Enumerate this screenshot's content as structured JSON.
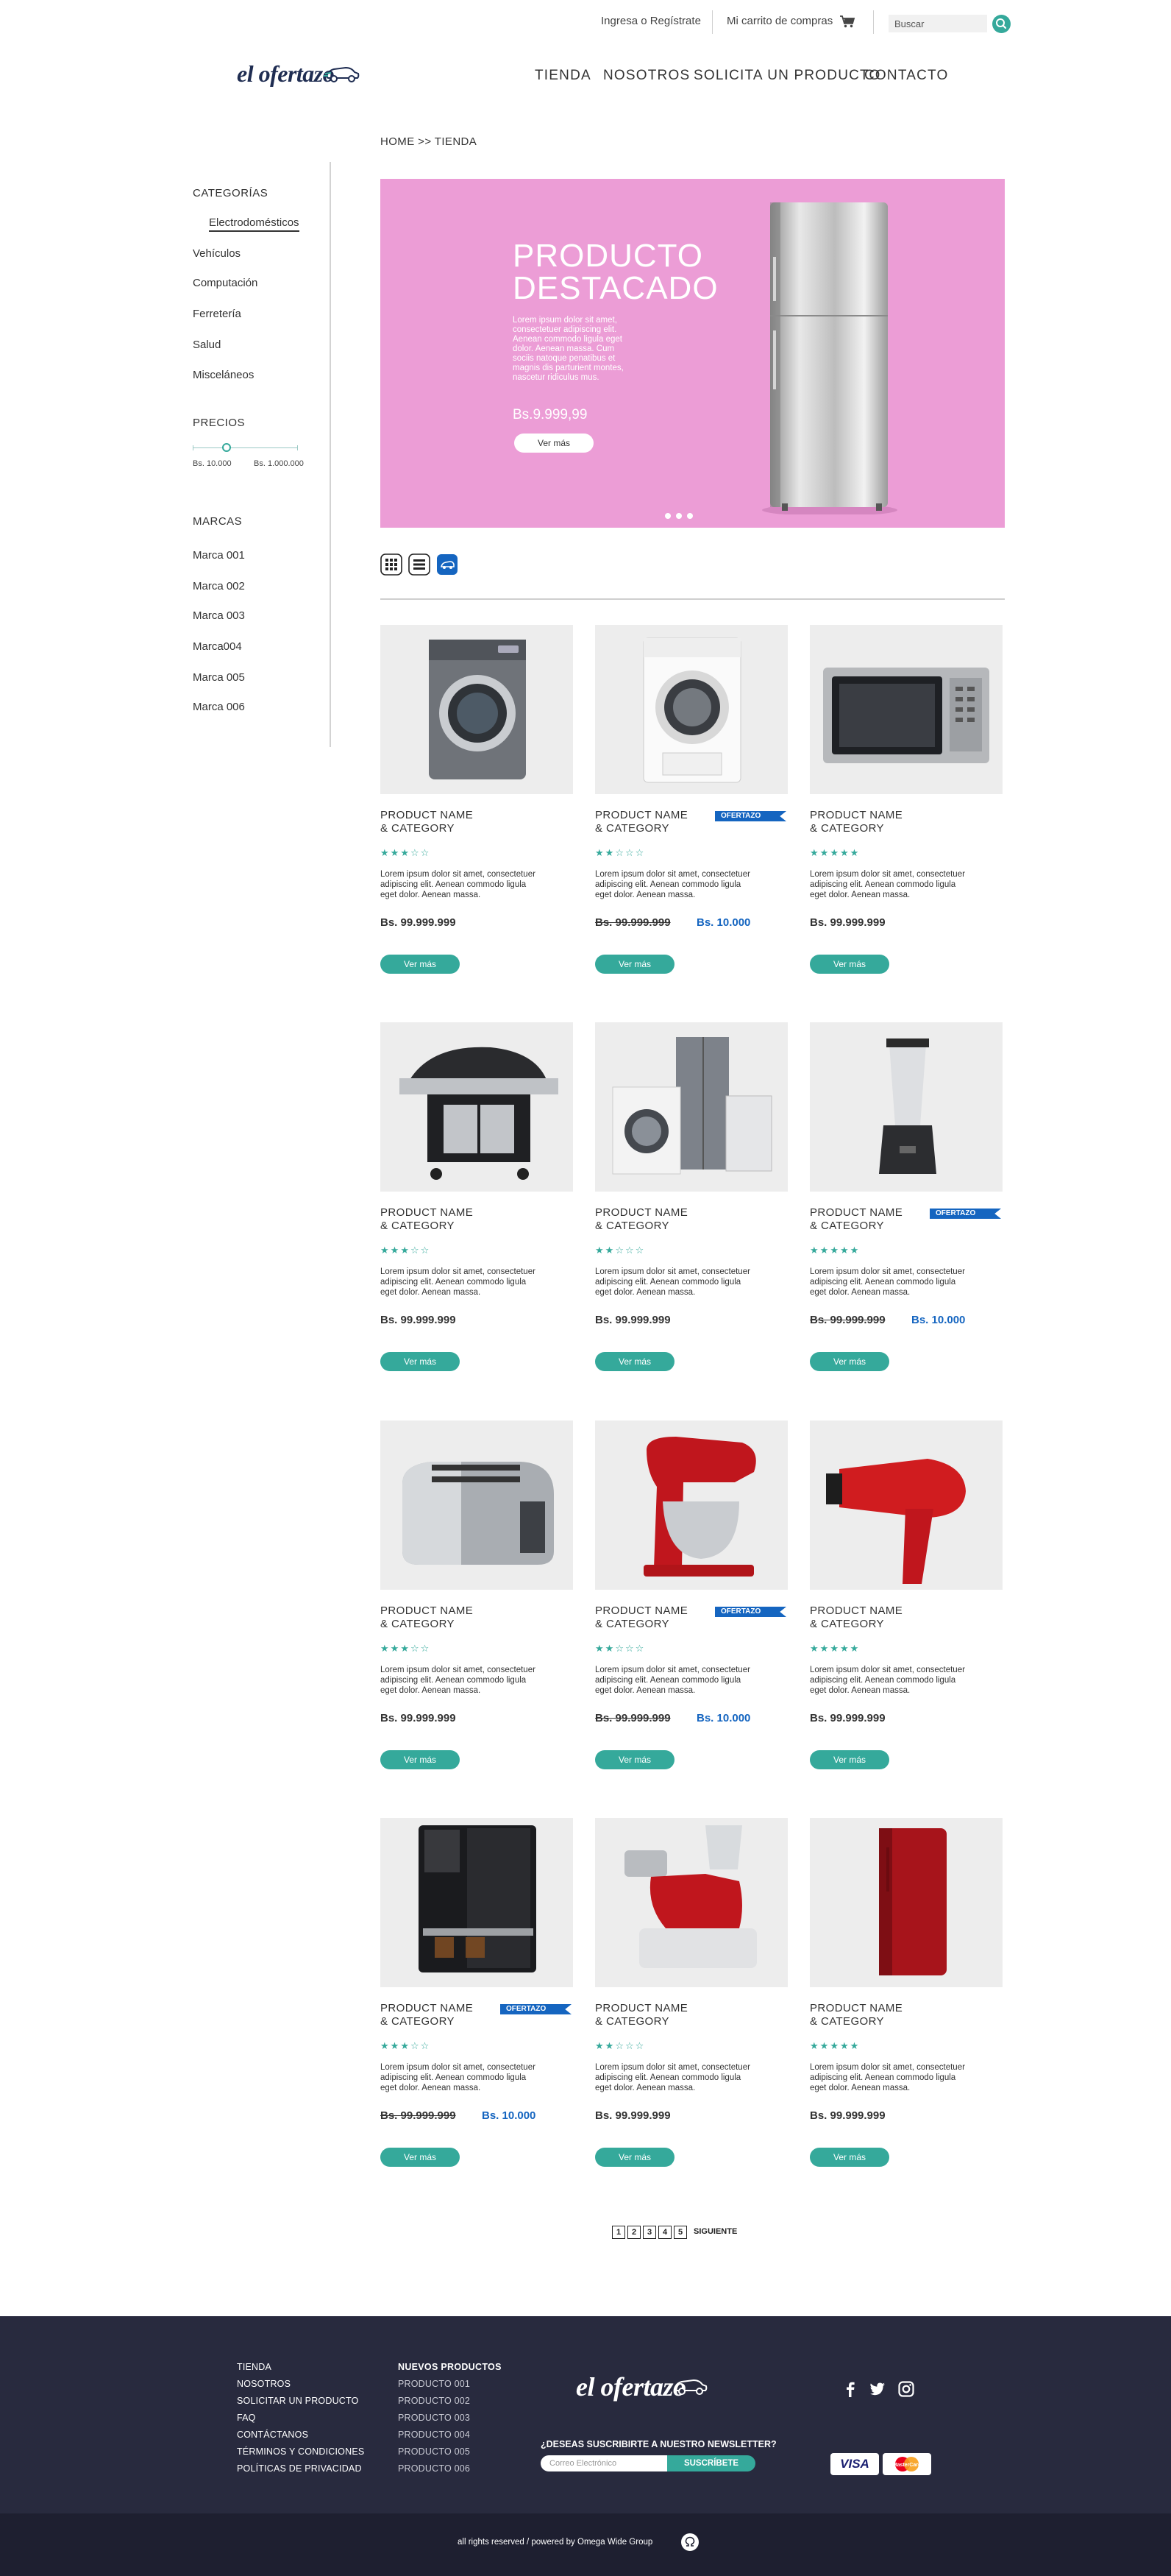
{
  "topbar": {
    "login_label": "Ingresa o Regístrate",
    "cart_label": "Mi carrito de compras",
    "search_placeholder": "Buscar"
  },
  "brand": {
    "logo_text": "el ofertazo"
  },
  "nav": [
    "TIENDA",
    "NOSOTROS",
    "SOLICITA UN PRODUCTO",
    "CONTACTO"
  ],
  "breadcrumb": "HOME >> TIENDA",
  "sidebar": {
    "categories_heading": "CATEGORÍAS",
    "categories": [
      "Electrodomésticos",
      "Vehículos",
      "Computación",
      "Ferretería",
      "Salud",
      "Misceláneos"
    ],
    "prices_heading": "PRECIOS",
    "price_min": "Bs. 10.000",
    "price_max": "Bs. 1.000.000",
    "price_slider_fraction": 0.33,
    "brands_heading": "MARCAS",
    "brands": [
      "Marca 001",
      "Marca 002",
      "Marca 003",
      "Marca004",
      "Marca 005",
      "Marca 006"
    ]
  },
  "hero": {
    "title_line1": "PRODUCTO",
    "title_line2": "DESTACADO",
    "text": "Lorem ipsum dolor sit amet, consectetuer adipiscing elit. Aenean commodo ligula eget dolor. Aenean massa. Cum sociis natoque penatibus et magnis dis parturient montes, nascetur ridiculus mus.",
    "price": "Bs.9.999,99",
    "button_label": "Ver más",
    "background_color": "#ec9dd6",
    "slide_count": 3
  },
  "view_toggles": [
    "grid-view-icon",
    "list-view-icon",
    "ofertazo-view-icon"
  ],
  "products": [
    {
      "name1": "PRODUCT NAME",
      "name2": "& CATEGORY",
      "image": "washing-machine-dark",
      "rating": 3,
      "badge": "",
      "price": "Bs. 99.999.999",
      "sale_price": "",
      "desc": "Lorem ipsum dolor sit amet, consectetuer adipiscing elit. Aenean commodo ligula eget dolor. Aenean massa.",
      "button": "Ver más"
    },
    {
      "name1": "PRODUCT NAME",
      "name2": "& CATEGORY",
      "image": "washing-machine-white",
      "rating": 2,
      "badge": "OFERTAZO",
      "price": "Bs. 99.999.999",
      "sale_price": "Bs. 10.000",
      "desc": "Lorem ipsum dolor sit amet, consectetuer adipiscing elit. Aenean commodo ligula eget dolor. Aenean massa.",
      "button": "Ver más"
    },
    {
      "name1": "PRODUCT NAME",
      "name2": "& CATEGORY",
      "image": "microwave",
      "rating": 5,
      "badge": "",
      "price": "Bs. 99.999.999",
      "sale_price": "",
      "desc": "Lorem ipsum dolor sit amet, consectetuer adipiscing elit. Aenean commodo ligula eget dolor. Aenean massa.",
      "button": "Ver más"
    },
    {
      "name1": "PRODUCT NAME",
      "name2": "& CATEGORY",
      "image": "grill",
      "rating": 3,
      "badge": "",
      "price": "Bs. 99.999.999",
      "sale_price": "",
      "desc": "Lorem ipsum dolor sit amet, consectetuer adipiscing elit. Aenean commodo ligula eget dolor. Aenean massa.",
      "button": "Ver más"
    },
    {
      "name1": "PRODUCT NAME",
      "name2": "& CATEGORY",
      "image": "appliance-set",
      "rating": 2,
      "badge": "",
      "price": "Bs. 99.999.999",
      "sale_price": "",
      "desc": "Lorem ipsum dolor sit amet, consectetuer adipiscing elit. Aenean commodo ligula eget dolor. Aenean massa.",
      "button": "Ver más"
    },
    {
      "name1": "PRODUCT NAME",
      "name2": "& CATEGORY",
      "image": "blender",
      "rating": 5,
      "badge": "OFERTAZO",
      "price": "Bs. 99.999.999",
      "sale_price": "Bs. 10.000",
      "desc": "Lorem ipsum dolor sit amet, consectetuer adipiscing elit. Aenean commodo ligula eget dolor. Aenean massa.",
      "button": "Ver más"
    },
    {
      "name1": "PRODUCT NAME",
      "name2": "& CATEGORY",
      "image": "toaster",
      "rating": 3,
      "badge": "",
      "price": "Bs. 99.999.999",
      "sale_price": "",
      "desc": "Lorem ipsum dolor sit amet, consectetuer adipiscing elit. Aenean commodo ligula eget dolor. Aenean massa.",
      "button": "Ver más"
    },
    {
      "name1": "PRODUCT NAME",
      "name2": "& CATEGORY",
      "image": "stand-mixer",
      "rating": 2,
      "badge": "OFERTAZO",
      "price": "Bs. 99.999.999",
      "sale_price": "Bs. 10.000",
      "desc": "Lorem ipsum dolor sit amet, consectetuer adipiscing elit. Aenean commodo ligula eget dolor. Aenean massa.",
      "button": "Ver más"
    },
    {
      "name1": "PRODUCT NAME",
      "name2": "& CATEGORY",
      "image": "hair-dryer",
      "rating": 5,
      "badge": "",
      "price": "Bs. 99.999.999",
      "sale_price": "",
      "desc": "Lorem ipsum dolor sit amet, consectetuer adipiscing elit. Aenean commodo ligula eget dolor. Aenean massa.",
      "button": "Ver más"
    },
    {
      "name1": "PRODUCT NAME",
      "name2": "& CATEGORY",
      "image": "espresso-machine",
      "rating": 3,
      "badge": "OFERTAZO",
      "price": "Bs. 99.999.999",
      "sale_price": "Bs. 10.000",
      "desc": "Lorem ipsum dolor sit amet, consectetuer adipiscing elit. Aenean commodo ligula eget dolor. Aenean massa.",
      "button": "Ver más"
    },
    {
      "name1": "PRODUCT NAME",
      "name2": "& CATEGORY",
      "image": "food-processor",
      "rating": 2,
      "badge": "",
      "price": "Bs. 99.999.999",
      "sale_price": "",
      "desc": "Lorem ipsum dolor sit amet, consectetuer adipiscing elit. Aenean commodo ligula eget dolor. Aenean massa.",
      "button": "Ver más"
    },
    {
      "name1": "PRODUCT NAME",
      "name2": "& CATEGORY",
      "image": "red-fridge",
      "rating": 5,
      "badge": "",
      "price": "Bs. 99.999.999",
      "sale_price": "",
      "desc": "Lorem ipsum dolor sit amet, consectetuer adipiscing elit. Aenean commodo ligula eget dolor. Aenean massa.",
      "button": "Ver más"
    }
  ],
  "pagination": {
    "pages": [
      "1",
      "2",
      "3",
      "4",
      "5"
    ],
    "next_label": "SIGUIENTE"
  },
  "footer": {
    "links": [
      "TIENDA",
      "NOSOTROS",
      "SOLICITAR UN PRODUCTO",
      "FAQ",
      "CONTÁCTANOS",
      "TÉRMINOS Y CONDICIONES",
      "POLÍTICAS DE PRIVACIDAD"
    ],
    "new_products_heading": "NUEVOS PRODUCTOS",
    "new_products": [
      "PRODUCTO 001",
      "PRODUCTO 002",
      "PRODUCTO 003",
      "PRODUCTO 004",
      "PRODUCTO 005",
      "PRODUCTO 006"
    ],
    "logo_text": "el ofertazo",
    "newsletter_label": "¿DESEAS SUSCRIBIRTE A NUESTRO NEWSLETTER?",
    "newsletter_placeholder": "Correo Electrónico",
    "newsletter_button": "SUSCRÍBETE",
    "social": [
      "facebook-icon",
      "twitter-icon",
      "instagram-icon"
    ],
    "payment": [
      "VISA",
      "MasterCard"
    ],
    "copyright": "all rights reserved / powered by Omega Wide Group"
  },
  "colors": {
    "accent": "#35a99b",
    "offer_blue": "#1565c0",
    "footer_bg": "#282a3e",
    "footer_bottom": "#1e1f30",
    "hero_pink": "#ec9dd6",
    "brand_navy": "#1f2d52"
  }
}
